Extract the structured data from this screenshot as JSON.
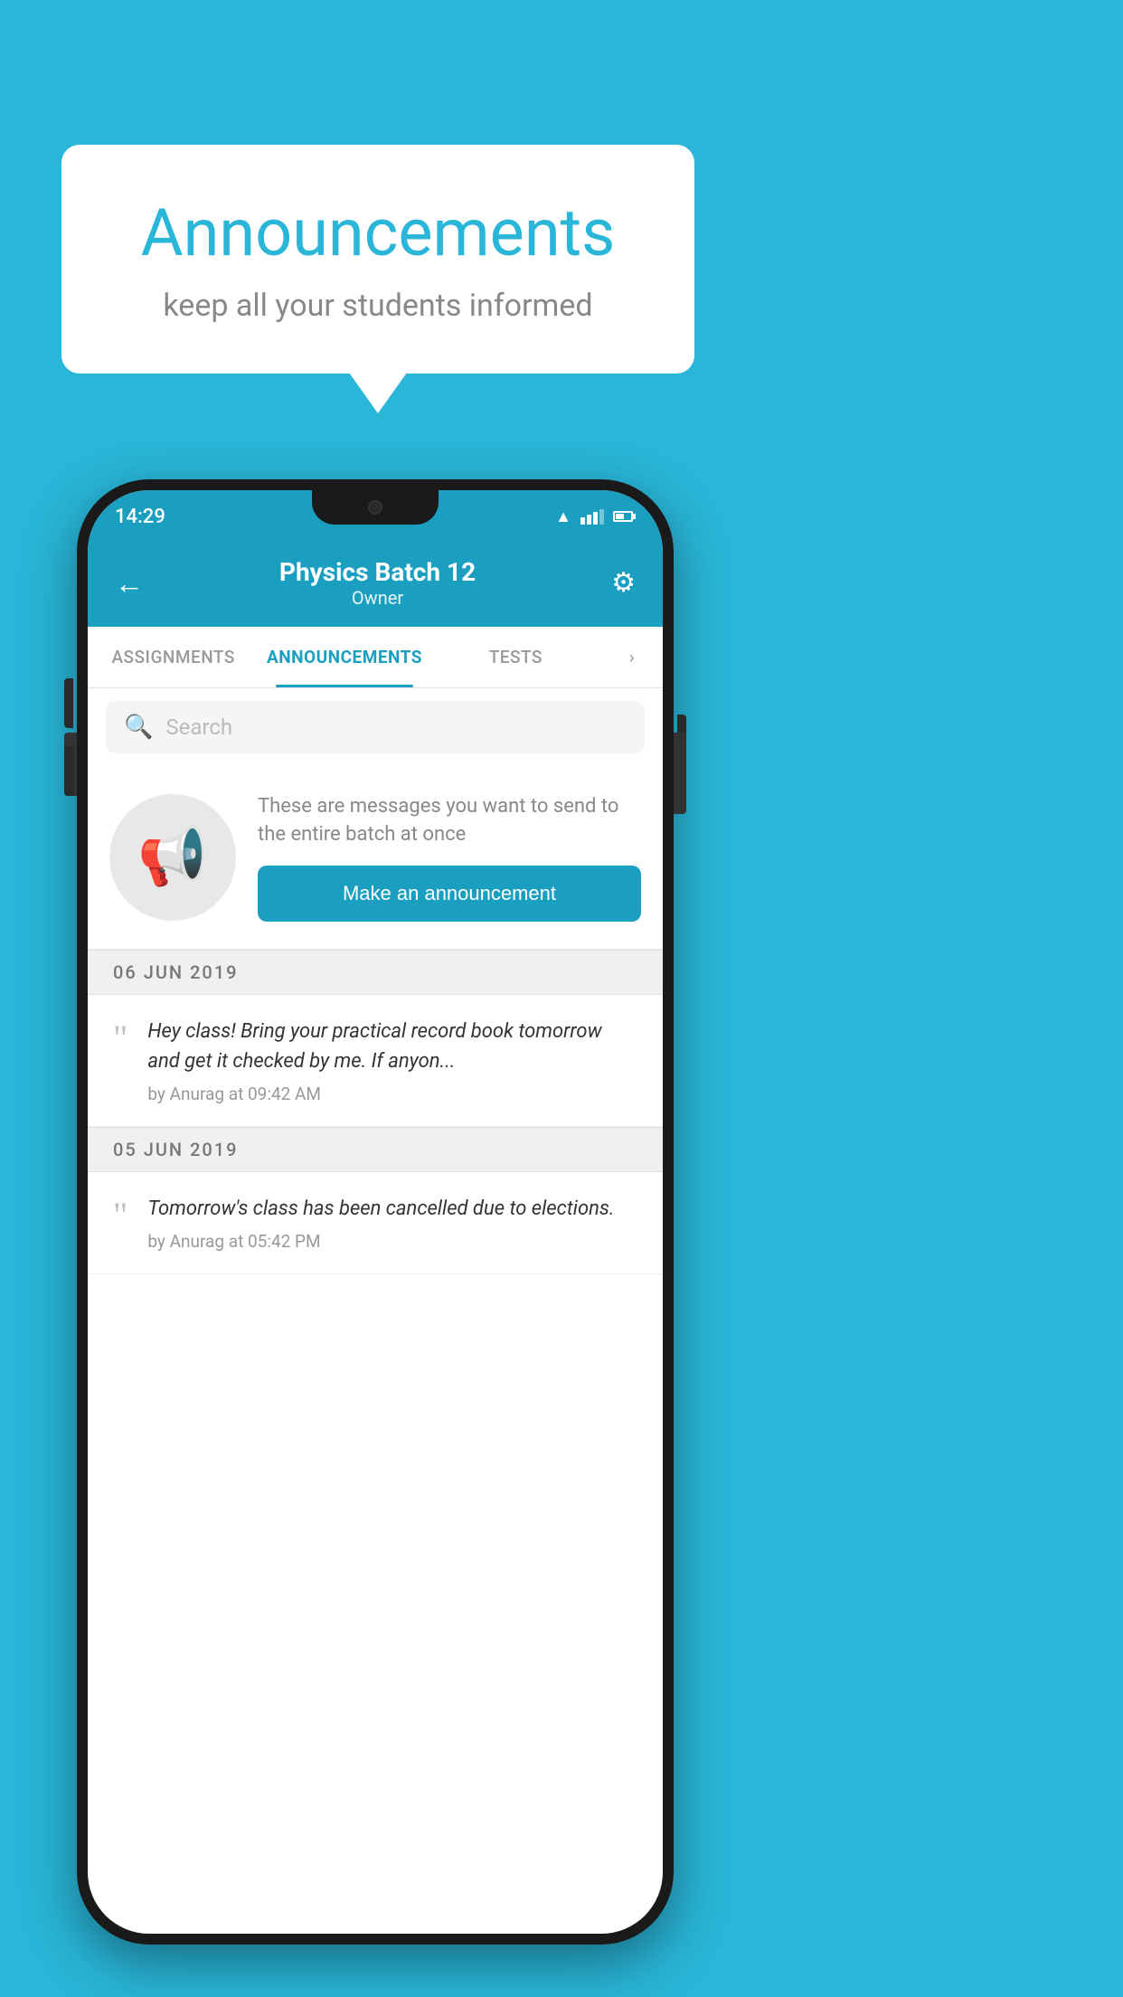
{
  "background_color": "#29b6d8",
  "speech_bubble": {
    "title": "Announcements",
    "subtitle": "keep all your students informed"
  },
  "phone": {
    "status_bar": {
      "time": "14:29"
    },
    "header": {
      "title": "Physics Batch 12",
      "subtitle": "Owner",
      "back_icon": "←",
      "gear_icon": "⚙"
    },
    "tabs": [
      {
        "label": "ASSIGNMENTS",
        "active": false
      },
      {
        "label": "ANNOUNCEMENTS",
        "active": true
      },
      {
        "label": "TESTS",
        "active": false
      },
      {
        "label": "...",
        "active": false
      }
    ],
    "search": {
      "placeholder": "Search"
    },
    "announcement_intro": {
      "description": "These are messages you want to send to the entire batch at once",
      "button_label": "Make an announcement"
    },
    "date_groups": [
      {
        "date": "06  JUN  2019",
        "items": [
          {
            "text": "Hey class! Bring your practical record book tomorrow and get it checked by me. If anyon...",
            "author": "by Anurag at 09:42 AM"
          }
        ]
      },
      {
        "date": "05  JUN  2019",
        "items": [
          {
            "text": "Tomorrow's class has been cancelled due to elections.",
            "author": "by Anurag at 05:42 PM"
          }
        ]
      }
    ]
  }
}
